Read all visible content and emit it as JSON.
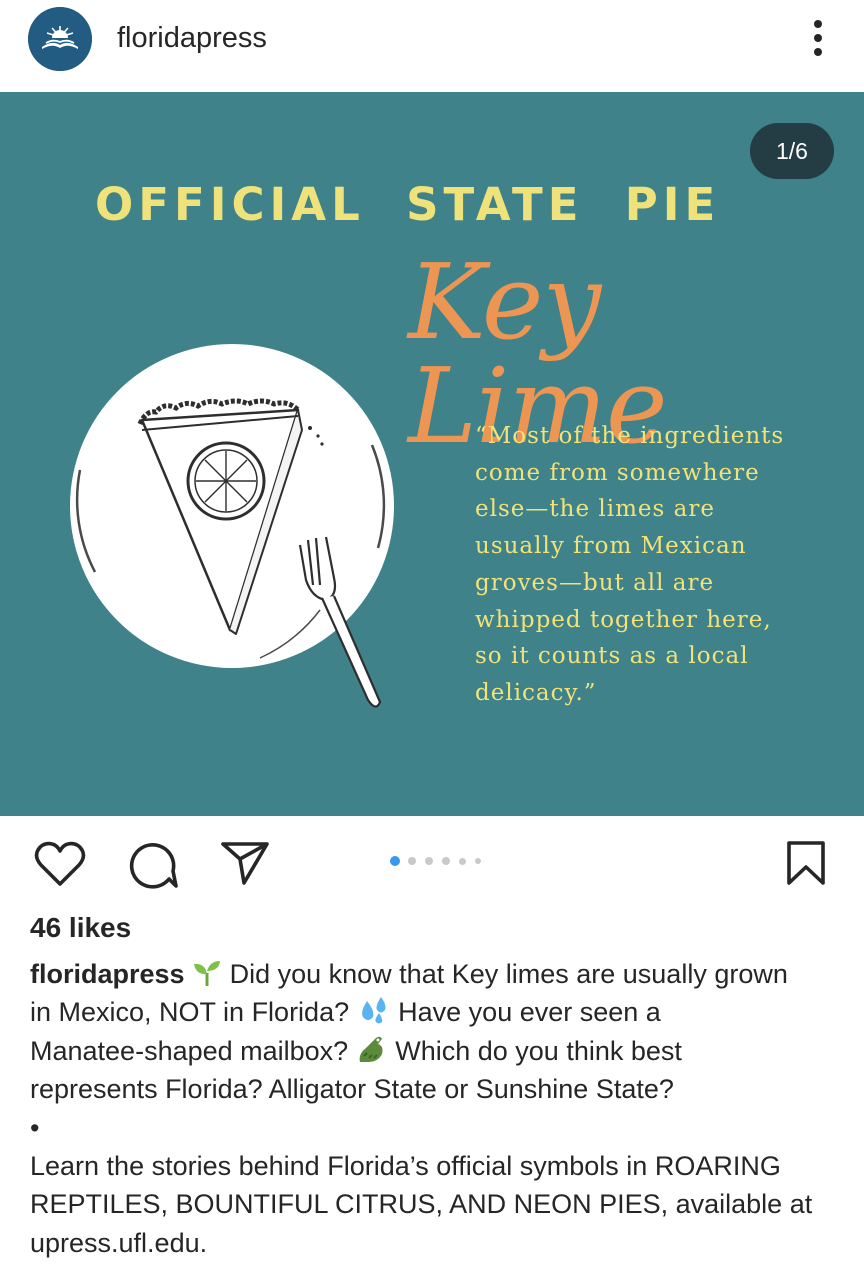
{
  "header": {
    "username": "floridapress",
    "avatar_icon": "florida-press-sunrise-logo",
    "more_icon": "more-vertical-icon"
  },
  "post": {
    "image": {
      "counter": "1/6",
      "headline": "OFFICIAL  STATE  PIE",
      "script_title": "Key Lime",
      "quote_lines": [
        "“Most of the ingredients",
        "come from somewhere",
        "else—the limes are",
        "usually from Mexican",
        "groves—but all are",
        "whipped together here,",
        "so it counts as a local",
        "delicacy.”"
      ],
      "background_color": "#3f8289",
      "headline_color": "#f0e27a",
      "script_color": "#ed9653"
    },
    "carousel": {
      "total": 6,
      "active_index": 0,
      "active_color": "#3897f0"
    },
    "actions": {
      "like_icon": "heart-icon",
      "comment_icon": "comment-bubble-icon",
      "share_icon": "paper-plane-icon",
      "save_icon": "bookmark-icon"
    },
    "likes": "46 likes",
    "caption": {
      "username": "floridapress",
      "line1_text": "Did you know that Key limes are usually grown",
      "line2_a": "in Mexico, NOT in Florida?",
      "line2_b": "Have you ever seen a",
      "line3_a": "Manatee-shaped mailbox?",
      "line3_b": "Which do you think best",
      "line4": "represents Florida? Alligator State or Sunshine State?",
      "bullet": "•",
      "line6": "Learn the stories behind Florida’s official symbols in ROARING",
      "line7": "REPTILES, BOUNTIFUL CITRUS, AND NEON PIES, available at",
      "line8": "upress.ufl.edu.",
      "emojis": [
        "seedling-emoji",
        "sweat-droplets-emoji",
        "crocodile-emoji"
      ]
    }
  }
}
